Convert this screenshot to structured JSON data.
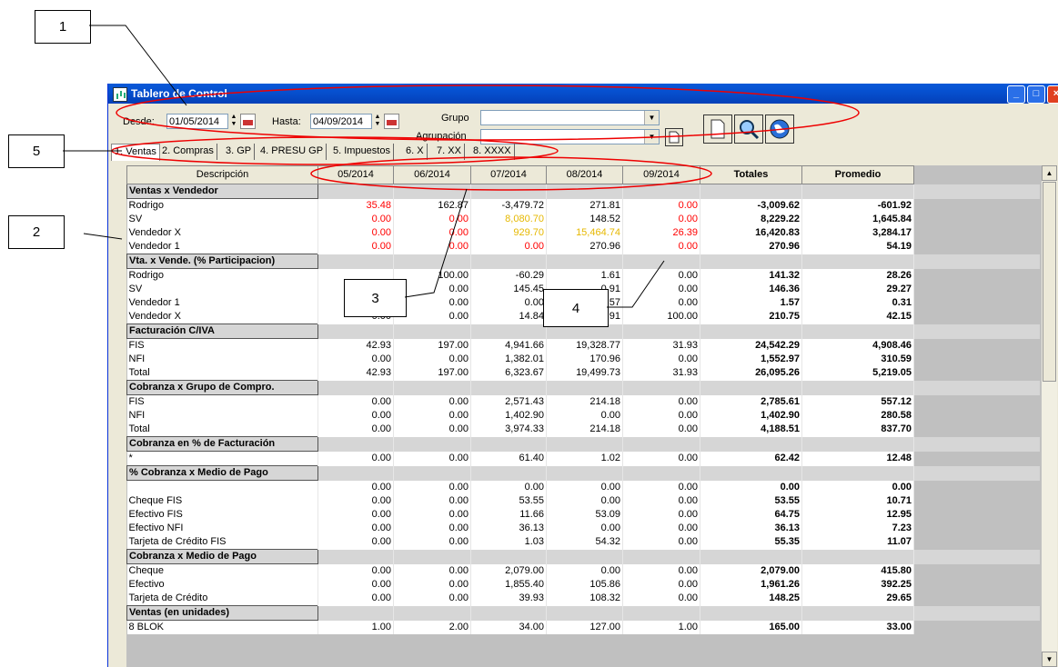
{
  "callouts": [
    "1",
    "2",
    "3",
    "4",
    "5"
  ],
  "window": {
    "title": "Tablero de Control"
  },
  "toolbar": {
    "desde_label": "Desde:",
    "desde_value": "01/05/2014",
    "hasta_label": "Hasta:",
    "hasta_value": "04/09/2014",
    "grupo_label": "Grupo",
    "agrupacion_label": "Agrupación"
  },
  "tabs": [
    "1. Ventas",
    "2. Compras",
    "3. GP",
    "4. PRESU GP",
    "5. Impuestos",
    "6. X",
    "7. XX",
    "8. XXXX"
  ],
  "columns": [
    "Descripción",
    "05/2014",
    "06/2014",
    "07/2014",
    "08/2014",
    "09/2014",
    "Totales",
    "Promedio"
  ],
  "rows": [
    {
      "desc": "Ventas x Vendedor",
      "section": true
    },
    {
      "desc": "Rodrigo",
      "v": [
        "35.48",
        "162.87",
        "-3,479.72",
        "271.81",
        "0.00"
      ],
      "c": [
        "red",
        "",
        "",
        "",
        "red"
      ],
      "t": "-3,009.62",
      "p": "-601.92"
    },
    {
      "desc": "SV",
      "v": [
        "0.00",
        "0.00",
        "8,080.70",
        "148.52",
        "0.00"
      ],
      "c": [
        "red",
        "red",
        "yel",
        "",
        "red"
      ],
      "t": "8,229.22",
      "p": "1,645.84"
    },
    {
      "desc": "Vendedor X",
      "v": [
        "0.00",
        "0.00",
        "929.70",
        "15,464.74",
        "26.39"
      ],
      "c": [
        "red",
        "red",
        "yel",
        "yel",
        "red"
      ],
      "t": "16,420.83",
      "p": "3,284.17"
    },
    {
      "desc": "Vendedor 1",
      "v": [
        "0.00",
        "0.00",
        "0.00",
        "270.96",
        "0.00"
      ],
      "c": [
        "red",
        "red",
        "red",
        "",
        "red"
      ],
      "t": "270.96",
      "p": "54.19"
    },
    {
      "desc": "Vta. x Vende. (% Participacion)",
      "section": true
    },
    {
      "desc": "Rodrigo",
      "v": [
        "",
        "100.00",
        "-60.29",
        "1.61",
        "0.00"
      ],
      "t": "141.32",
      "p": "28.26"
    },
    {
      "desc": "SV",
      "v": [
        "",
        "0.00",
        "145.45",
        "0.91",
        "0.00"
      ],
      "t": "146.36",
      "p": "29.27"
    },
    {
      "desc": "Vendedor 1",
      "v": [
        "0.00",
        "0.00",
        "0.00",
        "1.57",
        "0.00"
      ],
      "t": "1.57",
      "p": "0.31"
    },
    {
      "desc": "Vendedor X",
      "v": [
        "0.00",
        "0.00",
        "14.84",
        "95.91",
        "100.00"
      ],
      "t": "210.75",
      "p": "42.15"
    },
    {
      "desc": "Facturación C/IVA",
      "section": true
    },
    {
      "desc": "FIS",
      "v": [
        "42.93",
        "197.00",
        "4,941.66",
        "19,328.77",
        "31.93"
      ],
      "t": "24,542.29",
      "p": "4,908.46"
    },
    {
      "desc": "NFI",
      "v": [
        "0.00",
        "0.00",
        "1,382.01",
        "170.96",
        "0.00"
      ],
      "t": "1,552.97",
      "p": "310.59"
    },
    {
      "desc": "Total",
      "v": [
        "42.93",
        "197.00",
        "6,323.67",
        "19,499.73",
        "31.93"
      ],
      "t": "26,095.26",
      "p": "5,219.05"
    },
    {
      "desc": "Cobranza x Grupo de Compro.",
      "section": true
    },
    {
      "desc": "FIS",
      "v": [
        "0.00",
        "0.00",
        "2,571.43",
        "214.18",
        "0.00"
      ],
      "t": "2,785.61",
      "p": "557.12"
    },
    {
      "desc": "NFI",
      "v": [
        "0.00",
        "0.00",
        "1,402.90",
        "0.00",
        "0.00"
      ],
      "t": "1,402.90",
      "p": "280.58"
    },
    {
      "desc": "Total",
      "v": [
        "0.00",
        "0.00",
        "3,974.33",
        "214.18",
        "0.00"
      ],
      "t": "4,188.51",
      "p": "837.70"
    },
    {
      "desc": "Cobranza en % de Facturación",
      "section": true
    },
    {
      "desc": "*",
      "v": [
        "0.00",
        "0.00",
        "61.40",
        "1.02",
        "0.00"
      ],
      "t": "62.42",
      "p": "12.48"
    },
    {
      "desc": "% Cobranza x Medio de Pago",
      "section": true
    },
    {
      "desc": "",
      "v": [
        "0.00",
        "0.00",
        "0.00",
        "0.00",
        "0.00"
      ],
      "t": "0.00",
      "p": "0.00"
    },
    {
      "desc": "Cheque FIS",
      "v": [
        "0.00",
        "0.00",
        "53.55",
        "0.00",
        "0.00"
      ],
      "t": "53.55",
      "p": "10.71"
    },
    {
      "desc": "Efectivo FIS",
      "v": [
        "0.00",
        "0.00",
        "11.66",
        "53.09",
        "0.00"
      ],
      "t": "64.75",
      "p": "12.95"
    },
    {
      "desc": "Efectivo NFI",
      "v": [
        "0.00",
        "0.00",
        "36.13",
        "0.00",
        "0.00"
      ],
      "t": "36.13",
      "p": "7.23"
    },
    {
      "desc": "Tarjeta de Crédito FIS",
      "v": [
        "0.00",
        "0.00",
        "1.03",
        "54.32",
        "0.00"
      ],
      "t": "55.35",
      "p": "11.07"
    },
    {
      "desc": "Cobranza x Medio de Pago",
      "section": true
    },
    {
      "desc": "Cheque",
      "v": [
        "0.00",
        "0.00",
        "2,079.00",
        "0.00",
        "0.00"
      ],
      "t": "2,079.00",
      "p": "415.80"
    },
    {
      "desc": "Efectivo",
      "v": [
        "0.00",
        "0.00",
        "1,855.40",
        "105.86",
        "0.00"
      ],
      "t": "1,961.26",
      "p": "392.25"
    },
    {
      "desc": "Tarjeta de Crédito",
      "v": [
        "0.00",
        "0.00",
        "39.93",
        "108.32",
        "0.00"
      ],
      "t": "148.25",
      "p": "29.65"
    },
    {
      "desc": "Ventas (en unidades)",
      "section": true
    },
    {
      "desc": "8 BLOK",
      "v": [
        "1.00",
        "2.00",
        "34.00",
        "127.00",
        "1.00"
      ],
      "t": "165.00",
      "p": "33.00"
    }
  ]
}
